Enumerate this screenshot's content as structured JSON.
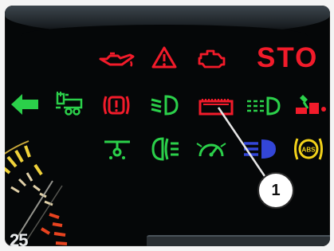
{
  "panel": {
    "stop_label": "STO",
    "callout_number": "1",
    "gauge_reading": "25"
  },
  "colors": {
    "red": "#f21b2a",
    "green": "#2bd04a",
    "blue": "#3346d8",
    "yellow": "#f2d21a"
  },
  "icons": {
    "row1": [
      "oil-pressure-icon",
      "warning-triangle-icon",
      "engine-check-icon"
    ],
    "row2": [
      "left-turn-arrow-icon",
      "trailer-icon",
      "brake-warning-icon",
      "low-beam-icon",
      "battery-charge-icon",
      "front-fog-icon",
      "parking-brake-icon"
    ],
    "row3": [
      "low-fuel-icon",
      "rear-fog-icon",
      "cruise-control-icon",
      "high-beam-icon",
      "abs-icon"
    ],
    "abs_label": "ABS"
  }
}
